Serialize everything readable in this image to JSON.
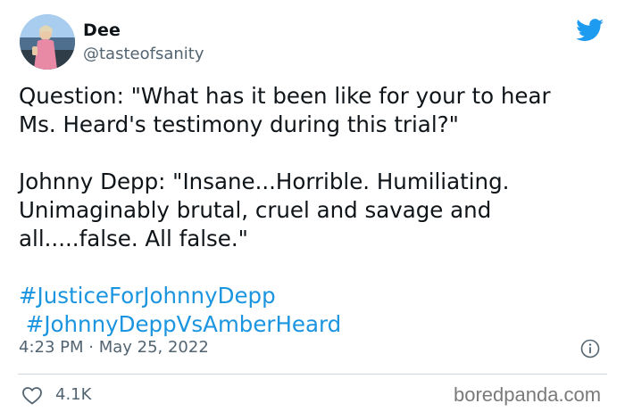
{
  "author": {
    "name": "Dee",
    "handle": "@tasteofsanity",
    "avatar_icon": "profile-photo"
  },
  "tweet": {
    "paragraph1": "Question: \"What has it been like for your to hear\nMs. Heard's testimony during this trial?\"",
    "paragraph2": "Johnny Depp: \"Insane...Horrible. Humiliating.\nUnimaginably brutal, cruel and savage and\nall.....false. All false.\"",
    "hashtags": [
      "#JusticeForJohnnyDepp",
      " #JohnnyDeppVsAmberHeard"
    ]
  },
  "meta": {
    "timestamp": "4:23 PM · May 25, 2022",
    "likes": "4.1K"
  },
  "watermark": "boredpanda.com",
  "colors": {
    "twitter_blue": "#1d9bf0",
    "hashtag": "#1b95e0",
    "secondary_text": "#536471"
  },
  "icons": {
    "brand": "twitter-bird-icon",
    "info": "info-icon",
    "like": "heart-icon"
  }
}
